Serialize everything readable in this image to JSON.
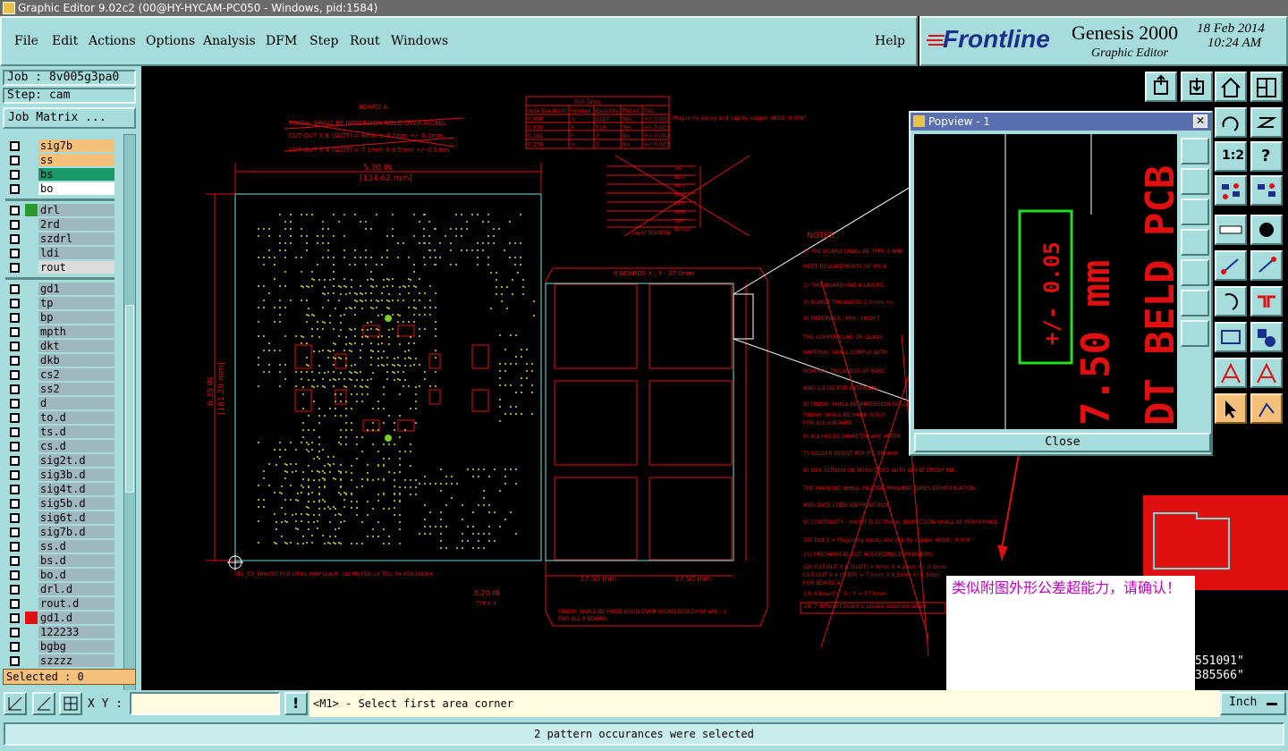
{
  "window": {
    "title": "Graphic Editor 9.02c2 (00@HY-HYCAM-PC050 - Windows, pid:1584)"
  },
  "menu": [
    "File",
    "Edit",
    "Actions",
    "Options",
    "Analysis",
    "DFM",
    "Step",
    "Rout",
    "Windows"
  ],
  "help_label": "Help",
  "brand": {
    "logo": "Frontline",
    "product": "Genesis 2000",
    "subtitle": "Graphic Editor",
    "date": "18 Feb 2014",
    "time": "10:24 AM"
  },
  "left": {
    "job": "Job : 8v005g3pa0",
    "step": "Step: cam",
    "job_matrix": "Job Matrix ...",
    "layers": [
      {
        "name": "sig7b",
        "color": "#f4c07a"
      },
      {
        "name": "ss",
        "color": "#f4c07a"
      },
      {
        "name": "bs",
        "color": "#1a9a6a"
      },
      {
        "name": "bo",
        "color": "#ffffff"
      },
      {
        "name": "drl",
        "color": "#9fb8bf",
        "active": "#2a9a2a"
      },
      {
        "name": "2rd",
        "color": "#9fb8bf"
      },
      {
        "name": "szdrl",
        "color": "#9fb8bf"
      },
      {
        "name": "ldi",
        "color": "#9fb8bf"
      },
      {
        "name": "rout",
        "color": "#dcdcdc"
      },
      {
        "name": "gd1",
        "color": "#9fb8bf"
      },
      {
        "name": "tp",
        "color": "#9fb8bf"
      },
      {
        "name": "bp",
        "color": "#9fb8bf"
      },
      {
        "name": "mpth",
        "color": "#9fb8bf"
      },
      {
        "name": "dkt",
        "color": "#9fb8bf"
      },
      {
        "name": "dkb",
        "color": "#9fb8bf"
      },
      {
        "name": "cs2",
        "color": "#9fb8bf"
      },
      {
        "name": "ss2",
        "color": "#9fb8bf"
      },
      {
        "name": "d",
        "color": "#9fb8bf"
      },
      {
        "name": "to.d",
        "color": "#9fb8bf"
      },
      {
        "name": "ts.d",
        "color": "#9fb8bf"
      },
      {
        "name": "cs.d",
        "color": "#9fb8bf"
      },
      {
        "name": "sig2t.d",
        "color": "#9fb8bf"
      },
      {
        "name": "sig3b.d",
        "color": "#9fb8bf"
      },
      {
        "name": "sig4t.d",
        "color": "#9fb8bf"
      },
      {
        "name": "sig5b.d",
        "color": "#9fb8bf"
      },
      {
        "name": "sig6t.d",
        "color": "#9fb8bf"
      },
      {
        "name": "sig7b.d",
        "color": "#9fb8bf"
      },
      {
        "name": "ss.d",
        "color": "#9fb8bf"
      },
      {
        "name": "bs.d",
        "color": "#9fb8bf"
      },
      {
        "name": "bo.d",
        "color": "#9fb8bf"
      },
      {
        "name": "drl.d",
        "color": "#9fb8bf"
      },
      {
        "name": "rout.d",
        "color": "#9fb8bf"
      },
      {
        "name": "gd1.d",
        "color": "#9fb8bf",
        "active": "#e01010"
      },
      {
        "name": "122233",
        "color": "#9fb8bf"
      },
      {
        "name": "bgbg",
        "color": "#9fb8bf"
      },
      {
        "name": "szzzz",
        "color": "#9fb8bf"
      }
    ],
    "selected": "Selected : 0"
  },
  "drawing": {
    "board_label": "BOARD A",
    "width_dim": "5.30 IN",
    "width_dim_mm": "[134.62 mm]",
    "height_dim": "6.35 IN",
    "height_dim_mm": "[161.29 mm]",
    "array_label": "6 BOARDS X , Y : 37.0mm",
    "dim_37_50": "37.50 mm",
    "dim_8_20": "8.20 IN",
    "typ": "TYP X 4",
    "footer": "SKL_DT_FANOUT.PCB   DRILL-MAP   D.A.M. Ltd  08-FEB-14  TEL: 04-8583583/4",
    "drill_table_title": "Drill Table",
    "drill_table_headers": [
      "Hole Dia (Inch)",
      "Symbol",
      "Quantity",
      "Plated",
      "TOL"
    ],
    "drill_table_rows": [
      [
        "0.008",
        "+",
        "5117",
        "Yes",
        "+/- 0.002"
      ],
      [
        "0.030",
        "X",
        "519",
        "Yes",
        "+/- 0.003"
      ],
      [
        "0.101",
        "Y",
        "3",
        "No",
        "+/- 0.002"
      ],
      [
        "0.236",
        "+",
        "2",
        "No",
        "+/- 0.003"
      ]
    ],
    "plug_note": "Plug in by epoxy and cap by copper  HOLE :0.008\"",
    "stackup_label": "Layer StackUp",
    "stackup_layers": [
      "Top",
      "INT2",
      "INT3",
      "INT4",
      "INT5",
      "INT6",
      "INT7",
      "Bottom"
    ],
    "notes_title": "NOTES :",
    "notes": [
      "1) THE BOARD SHALL BE TYPE-3 AND",
      "   MEET REQUIREMENTS OF IPC-6",
      "2) THIS BOARD HAS 8 LAYERS.",
      "3) BOARD THICKNESS 2.0 mm  +/-",
      "4)  MATERIALS : FR4 - HIGH T",
      "    THE COPPER CLAD OR GLASS",
      "    MATERIAL SHALL COMPLY WITH",
      "    NOMINAL THICKNESS OF BASE",
      "    AND  1/2  OZ FOR EXTERNAL",
      "5)  FINISH: SHALL BE IMMERSION GOLD",
      "    FINISH: SHALL BE HARD GOLD",
      "    FOR ALL 6 BOARD.",
      "6)  ALL HOLES DIAMETER ARE AFTER",
      "7)  SOLDER RESIST PER IPC-SM-840",
      "8)  SILK SCREEN ON BOTH SIDES WITH WHITE EPOXY INK.",
      "    THE MARKING SHALL INCLUDE MANUFACTURES IDENTIFICATION",
      "    AND DATE CODE ON PRINT SIDE.",
      "9)  CONTINUITY - SHORT ELECTRICAL INSPECTION SHALL BE PERFORMED",
      "10) Tool 1 = Plug in by epoxy and cap by copper  HOLE : 0.008 \"",
      "11)  MECHANICAL CUT ACCORDING DIMENSIONS.",
      "12)  CUT-OUT X  6  (SLOT) =  6mm  X  4.2mm  +/- 0.1mm.",
      "     CUT-OUT X  4  (SLOT) =  7.1mm  X  9.5mm  +/-0.1mm.",
      "     FOR BOARD A.",
      "13) 6 board's : X , Y = 37.5mm.",
      "14)  7 different board's,  please  separate  when"
    ],
    "finish_top": "FINISH: SHALL BE IMMERSION GOLD OVER NICKEL",
    "cutout1": "CUT-OUT X  6 (SLOT) =  6mm X 4.2mm +/- 0.1mm.",
    "cutout2": "CUT-OUT X  4 (SLOT) = 7.1mm X 9.5mm +/- 0.1mm.",
    "array_finish1": "FINISH: SHALL BE HARD GOLD OVER NICKEL(GOLD=50 uIN ...)",
    "array_finish2": "FOR ALL 6 BOARD."
  },
  "popview": {
    "title": "Popview - 1",
    "tolerance": "+/- 0.05",
    "dim_text": "7.50 mm",
    "partial_text": "DT_BELD PCB",
    "close_label": "Close"
  },
  "annotation": "类似附图外形公差超能力，请确认！",
  "coords": {
    "x": "551091\"",
    "y": "385566\""
  },
  "status": {
    "xy_label": "X Y :",
    "xy_value": "",
    "prompt": "<M1> - Select first area corner",
    "unit": "Inch",
    "message": "2 pattern occurances were selected"
  },
  "colors": {
    "panel": "#a7dcdc",
    "drawing": "#e01010",
    "profile": "#6fdede",
    "highlight": "#22dd22"
  }
}
